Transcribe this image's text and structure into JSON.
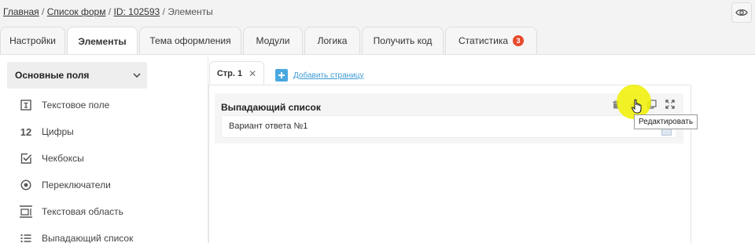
{
  "breadcrumb": {
    "home": "Главная",
    "sep": "/",
    "forms_list": "Список форм",
    "form_id": "ID: 102593",
    "current": "Элементы"
  },
  "header": {
    "preview_icon": "eye-icon"
  },
  "tabs": [
    {
      "label": "Настройки",
      "active": false
    },
    {
      "label": "Элементы",
      "active": true
    },
    {
      "label": "Тема оформления",
      "active": false
    },
    {
      "label": "Модули",
      "active": false
    },
    {
      "label": "Логика",
      "active": false
    },
    {
      "label": "Получить код",
      "active": false
    },
    {
      "label": "Статистика",
      "active": false,
      "badge": "3"
    }
  ],
  "sidebar": {
    "section_title": "Основные поля",
    "items": [
      {
        "icon": "text-field-icon",
        "label": "Текстовое поле"
      },
      {
        "icon": "digits-icon",
        "glyph": "12",
        "label": "Цифры"
      },
      {
        "icon": "checkbox-icon",
        "label": "Чекбоксы"
      },
      {
        "icon": "radio-icon",
        "label": "Переключатели"
      },
      {
        "icon": "textarea-icon",
        "label": "Текстовая область"
      },
      {
        "icon": "dropdown-list-icon",
        "label": "Выпадающий список"
      }
    ]
  },
  "pages": {
    "tabs": [
      {
        "label": "Стр. 1"
      }
    ],
    "add_page_label": "Добавить страницу"
  },
  "canvas": {
    "field": {
      "title": "Выпадающий список",
      "option_value": "Вариант ответа №1",
      "tools": [
        "trash-icon",
        "edit-icon",
        "copy-icon",
        "expand-icon"
      ]
    },
    "tooltip": "Редактировать"
  },
  "colors": {
    "badge": "#e8492c",
    "add_page_link": "#3d9bd6",
    "highlight": "#f0f000"
  }
}
